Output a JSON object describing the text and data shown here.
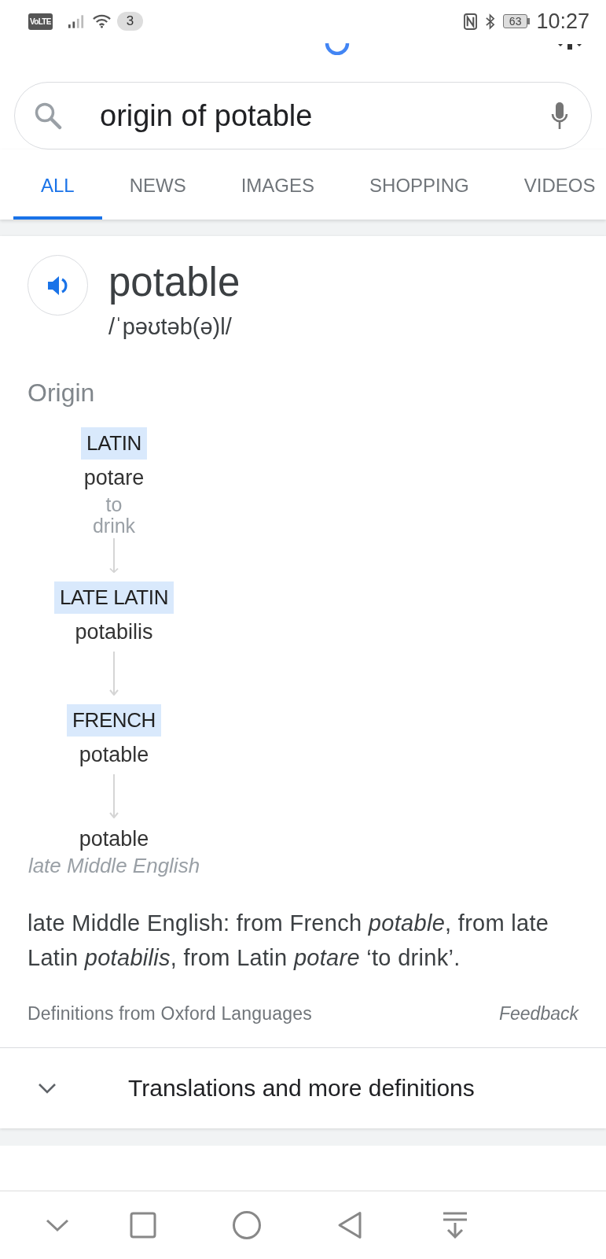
{
  "status_bar": {
    "network_badge": "VoLTE",
    "notification_count": "3",
    "battery": "63",
    "time": "10:27"
  },
  "search": {
    "value": "origin of potable"
  },
  "tabs": [
    {
      "label": "ALL",
      "selected": true
    },
    {
      "label": "NEWS",
      "selected": false
    },
    {
      "label": "IMAGES",
      "selected": false
    },
    {
      "label": "SHOPPING",
      "selected": false
    },
    {
      "label": "VIDEOS",
      "selected": false
    }
  ],
  "dictionary_card": {
    "word": "potable",
    "pronunciation": "/ˈpəʊtəb(ə)l/",
    "origin_heading": "Origin",
    "origin_chain": [
      {
        "language": "LATIN",
        "word": "potare",
        "gloss": "to drink"
      },
      {
        "language": "LATE LATIN",
        "word": "potabilis"
      },
      {
        "language": "FRENCH",
        "word": "potable"
      },
      {
        "word": "potable",
        "note": "late Middle English"
      }
    ],
    "etymology": "late Middle English: from French *potable*, from late Latin *potabilis*, from Latin *potare* ‘to drink’.",
    "source": "Definitions from Oxford Languages",
    "feedback": "Feedback"
  },
  "more_definitions": {
    "label": "Translations and more definitions",
    "expanded": false
  }
}
